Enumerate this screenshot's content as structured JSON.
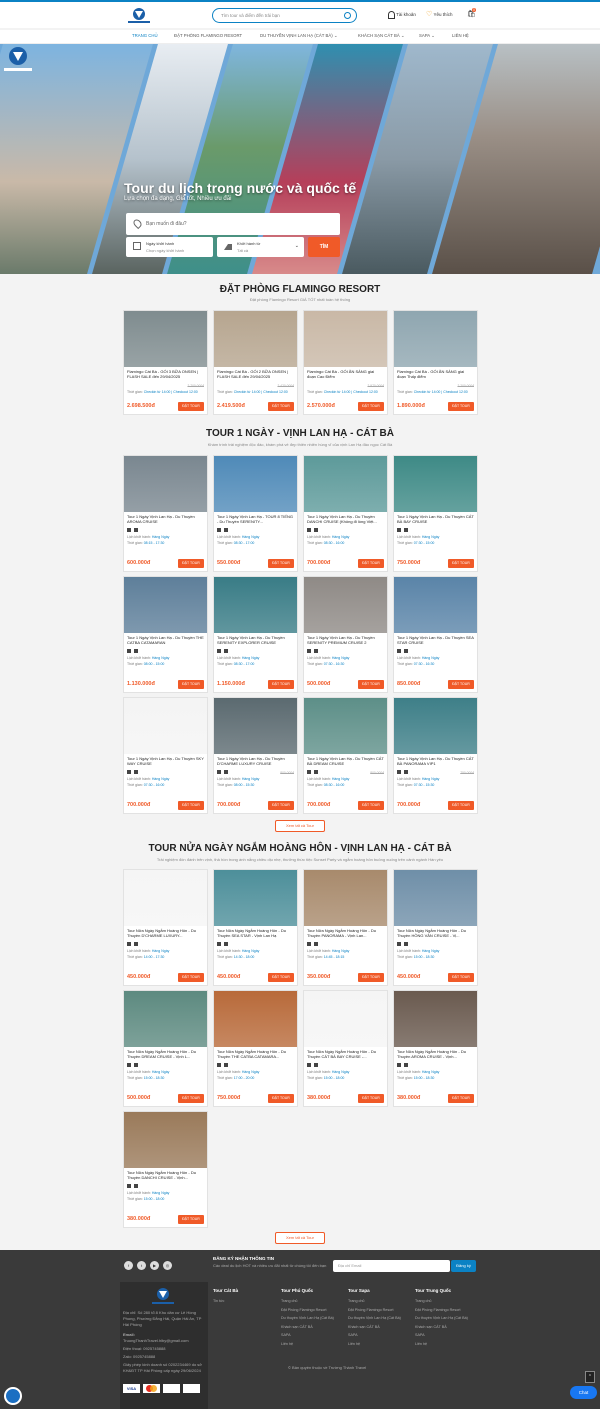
{
  "header": {
    "search_placeholder": "Tìm tour và điểm đến trải bạn",
    "account": "Tài khoản",
    "wishlist": "Yêu thích",
    "cart_count": "0"
  },
  "nav": [
    "TRANG CHỦ",
    "ĐẶT PHÒNG FLAMINGO RESORT",
    "DU THUYỀN VỊNH LAN HẠ (CÁT BÀ) ⌄",
    "KHÁCH SẠN CÁT BÀ ⌄",
    "SAPA ⌄",
    "LIÊN HỆ"
  ],
  "hero": {
    "title": "Tour du lịch trong nước và quốc tế",
    "subtitle": "Lựa chọn đa dạng, Giá tốt, Nhiều ưu đãi",
    "where_placeholder": "Bạn muốn đi đâu?",
    "date_label": "Ngày khởi hành",
    "date_value": "Chọn ngày khởi hành",
    "from_label": "Khởi hành từ",
    "from_value": "Tất cả",
    "search_btn": "TÌM"
  },
  "sections": [
    {
      "title": "ĐẶT PHÒNG FLAMINGO RESORT",
      "subtitle": "Đặt phòng Flamingo Resort GIÁ TỐT nhất toàn hệ thống",
      "cards": [
        {
          "title": "Flamingo Cát Bà - GÓI 3 BỮA ONSEN | FLASH SALE đến 29/04/2025",
          "old": "2.700.000đ",
          "time_label": "Thời gian:",
          "time": "Checkin từ 14:00 | Checkout 12:00",
          "price": "2.698.500đ",
          "color": "#7f8c8f"
        },
        {
          "title": "Flamingo Cát Bà - GÓI 2 BỮA ONSEN | FLASH SALE đến 29/04/2025",
          "old": "2.420.000đ",
          "time_label": "Thời gian:",
          "time": "Checkin từ 14:00 | Checkout 12:00",
          "price": "2.419.500đ",
          "color": "#b6a58f"
        },
        {
          "title": "Flamingo Cát Bà - GÓI ĂN SÁNG giai đoạn Cao Điểm",
          "old": "2.970.000đ",
          "time_label": "Thời gian:",
          "time": "Checkin từ 14:00 | Checkout 12:00",
          "price": "2.570.000đ",
          "color": "#c9b8a6"
        },
        {
          "title": "Flamingo Cát Bà - GÓI ĂN SÁNG giai đoạn Thấp điểm",
          "old": "2.200.000đ",
          "time_label": "Thời gian:",
          "time": "Checkin từ 14:00 | Checkout 12:00",
          "price": "1.890.000đ",
          "color": "#8fa6b0"
        }
      ]
    },
    {
      "title": "TOUR 1 NGÀY - VỊNH LAN HẠ - CÁT BÀ",
      "subtitle": "Khám trình trải nghiệm độc đáo, khám phá vẻ đẹp thiên nhiên hùng vĩ của vịnh Lan Hạ đảo ngọc Cát Bà",
      "cards": [
        {
          "title": "Tour 1 Ngày Vịnh Lan Hạ - Du Thuyền AROMA CRUISE",
          "old": "",
          "schedule": "Hàng Ngày",
          "time": "08:15 - 17:30",
          "price": "600.000đ",
          "color": "#7a8790"
        },
        {
          "title": "Tour 1 Ngày Vịnh Lan Hạ - TOUR 8 TIẾNG - Du Thuyền SERENITY...",
          "old": "",
          "schedule": "Hàng Ngày",
          "time": "08:30 - 17:00",
          "price": "550.000đ",
          "color": "#4f8ab8"
        },
        {
          "title": "Tour 1 Ngày Vịnh Lan Hạ - Du Thuyền DANCHI CRUISE (Không đi lồng Việt...",
          "old": "",
          "schedule": "Hàng Ngày",
          "time": "08:30 - 16:00",
          "price": "700.000đ",
          "color": "#5d9a9a"
        },
        {
          "title": "Tour 1 Ngày Vịnh Lan Hạ - Du Thuyền CÁT BÀ BAY CRUISE",
          "old": "",
          "schedule": "Hàng Ngày",
          "time": "07:30 - 15:00",
          "price": "750.000đ",
          "color": "#3e8a86"
        },
        {
          "title": "Tour 1 Ngày Vịnh Lan Hạ - Du Thuyền THE CATBA CATAMARAN",
          "old": "",
          "schedule": "Hàng Ngày",
          "time": "08:00 - 15:00",
          "price": "1.130.000đ",
          "color": "#5e7f9a"
        },
        {
          "title": "Tour 1 Ngày Vịnh Lan Hạ - Du Thuyền SERENITY EXPLORER CRUISE",
          "old": "",
          "schedule": "Hàng Ngày",
          "time": "08:30 - 17:00",
          "price": "1.150.000đ",
          "color": "#397c86"
        },
        {
          "title": "Tour 1 Ngày Vịnh Lan Hạ - Du Thuyền SERENITY PREMIUM CRUISE 2",
          "old": "",
          "schedule": "Hàng Ngày",
          "time": "07:30 - 16:30",
          "price": "500.000đ",
          "color": "#8f8a86"
        },
        {
          "title": "Tour 1 Ngày Vịnh Lan Hạ - Du Thuyền SEA STAR CRUISE",
          "old": "",
          "schedule": "Hàng Ngày",
          "time": "07:30 - 16:30",
          "price": "850.000đ",
          "color": "#5a84a8"
        },
        {
          "title": "Tour 1 Ngày Vịnh Lan Hạ - Du Thuyền SKY WAY CRUISE",
          "old": "",
          "schedule": "Hàng Ngày",
          "time": "07:30 - 16:00",
          "price": "700.000đ",
          "color": "#f4f4f4"
        },
        {
          "title": "Tour 1 Ngày Vịnh Lan Hạ - Du Thuyền D'CHARME LUXURY CRUISE",
          "old": "800.000đ",
          "schedule": "Hàng Ngày",
          "time": "08:00 - 15:30",
          "price": "700.000đ",
          "color": "#5b6a70"
        },
        {
          "title": "Tour 1 Ngày Vịnh Lan Hạ - Du Thuyền CÁT BÀ DREAM CRUISE",
          "old": "800.000đ",
          "schedule": "Hàng Ngày",
          "time": "08:30 - 16:00",
          "price": "700.000đ",
          "color": "#5d8f88"
        },
        {
          "title": "Tour 1 Ngày Vịnh Lan Hạ - Du Thuyền CÁT BÀ PANORAMA VIP1",
          "old": "750.000đ",
          "schedule": "Hàng Ngày",
          "time": "07:30 - 15:30",
          "price": "700.000đ",
          "color": "#3e7f88"
        }
      ],
      "more": "Xem tất cả Tour"
    },
    {
      "title": "TOUR NỬA NGÀY NGẮM HOÀNG HÔN - VỊNH LAN HẠ - CÁT BÀ",
      "subtitle": "Trải nghiệm đón đánh trên vịnh, thả hồn trong ánh nắng chiều dịu nhẹ, thưởng thức tiệc Sunset Party và ngắm hoàng hôn buông xuống trên cảnh ngành Hàn yêu",
      "cards": [
        {
          "title": "Tour Nửa Ngày Ngắm Hoàng Hôn - Du Thuyền D'CHARME LUXURY...",
          "old": "",
          "schedule": "Hàng Ngày",
          "time": "14:00 - 17:30",
          "price": "450.000đ",
          "color": "#f5f5f5"
        },
        {
          "title": "Tour Nửa Ngày Ngắm Hoàng Hôn - Du Thuyền SEA STAR - Vịnh Lan Hạ",
          "old": "",
          "schedule": "Hàng Ngày",
          "time": "14:30 - 18:00",
          "price": "450.000đ",
          "color": "#4d8f9a"
        },
        {
          "title": "Tour Nửa Ngày Ngắm Hoàng Hôn - Du Thuyền PANORAMA - Vịnh Lan...",
          "old": "",
          "schedule": "Hàng Ngày",
          "time": "14:45 - 18:15",
          "price": "350.000đ",
          "color": "#a88a6c"
        },
        {
          "title": "Tour Nửa Ngày Ngắm Hoàng Hôn - Du Thuyền HỒNG VÂN CRUISE - Vị...",
          "old": "",
          "schedule": "Hàng Ngày",
          "time": "15:00 - 18:30",
          "price": "450.000đ",
          "color": "#6f8fa8"
        },
        {
          "title": "Tour Nửa Ngày Ngắm Hoàng Hôn - Du Thuyền DREAM CRUISE - Vịnh L...",
          "old": "",
          "schedule": "Hàng Ngày",
          "time": "15:00 - 18:30",
          "price": "500.000đ",
          "color": "#5d8a80"
        },
        {
          "title": "Tour Nửa Ngày Ngắm Hoàng Hôn - Du Thuyền THE CATBA CATAMARA...",
          "old": "",
          "schedule": "Hàng Ngày",
          "time": "17:00 - 20:00",
          "price": "750.000đ",
          "color": "#b86a3a"
        },
        {
          "title": "Tour Nửa Ngày Ngắm Hoàng Hôn - Du Thuyền CÁT BÀ BAY CRUISE -...",
          "old": "",
          "schedule": "Hàng Ngày",
          "time": "15:00 - 18:00",
          "price": "380.000đ",
          "color": "#f5f5f5"
        },
        {
          "title": "Tour Nửa Ngày Ngắm Hoàng Hôn - Du Thuyền AROMA CRUISE - Vịnh...",
          "old": "",
          "schedule": "Hàng Ngày",
          "time": "15:00 - 18:30",
          "price": "380.000đ",
          "color": "#6a5a4f"
        },
        {
          "title": "Tour Nửa Ngày Ngắm Hoàng Hôn - Du Thuyền DANCHI CRUISE - Vịnh...",
          "old": "",
          "schedule": "Hàng Ngày",
          "time": "15:00 - 18:00",
          "price": "380.000đ",
          "color": "#9a7a5a"
        }
      ],
      "more": "Xem tất cả Tour"
    }
  ],
  "card_labels": {
    "schedule": "Lịch khởi hành:",
    "time": "Thời gian:",
    "book": "ĐẶT TOUR"
  },
  "footer": {
    "newsletter_title": "ĐĂNG KÝ NHẬN THÔNG TIN",
    "newsletter_sub": "Các deal du lịch HOT và nhiều ưu đãi nhất từ chúng tôi đến bạn",
    "email_placeholder": "Địa chỉ Email",
    "email_btn": "Đăng ký",
    "address": "Địa chỉ: Số 280 tổ 8 Khu dân cư Lê Hồng Phong, Phường Đằng Hải, Quận Hải An, TP Hải Phòng",
    "email_label": "Email:",
    "email_value": "TruongThanhTravel.hlby@gmail.com",
    "phone": "Điện thoại: 0925745888",
    "zalo": "Zalo: 0925745888",
    "license": "Giấy phép kinh doanh số 0202234469 do sở KH&ĐT TP Hải Phòng cấp ngày 29/06/2024",
    "cols": [
      {
        "head": "Tour Cát Bà",
        "links": [
          "Tin tức"
        ]
      },
      {
        "head": "Tour Phú Quốc",
        "links": [
          "Trang chủ",
          "Đặt Phòng Flamingo Resort",
          "Du thuyền Vịnh Lan Hạ (Cát Bà)",
          "Khách sạn CÁT BÀ",
          "SAPA",
          "Liên hệ"
        ]
      },
      {
        "head": "Tour Sapa",
        "links": [
          "Trang chủ",
          "Đặt Phòng Flamingo Resort",
          "Du thuyền Vịnh Lan Hạ (Cát Bà)",
          "Khách sạn CÁT BÀ",
          "SAPA",
          "Liên hệ"
        ]
      },
      {
        "head": "Tour Trung Quốc",
        "links": [
          "Trang chủ",
          "Đặt Phòng Flamingo Resort",
          "Du thuyền Vịnh Lan Hạ (Cát Bà)",
          "Khách sạn CÁT BÀ",
          "SAPA",
          "Liên hệ"
        ]
      }
    ],
    "copyright": "© Bản quyền thuộc về Trường Thành Travel",
    "chat": "Chat"
  }
}
